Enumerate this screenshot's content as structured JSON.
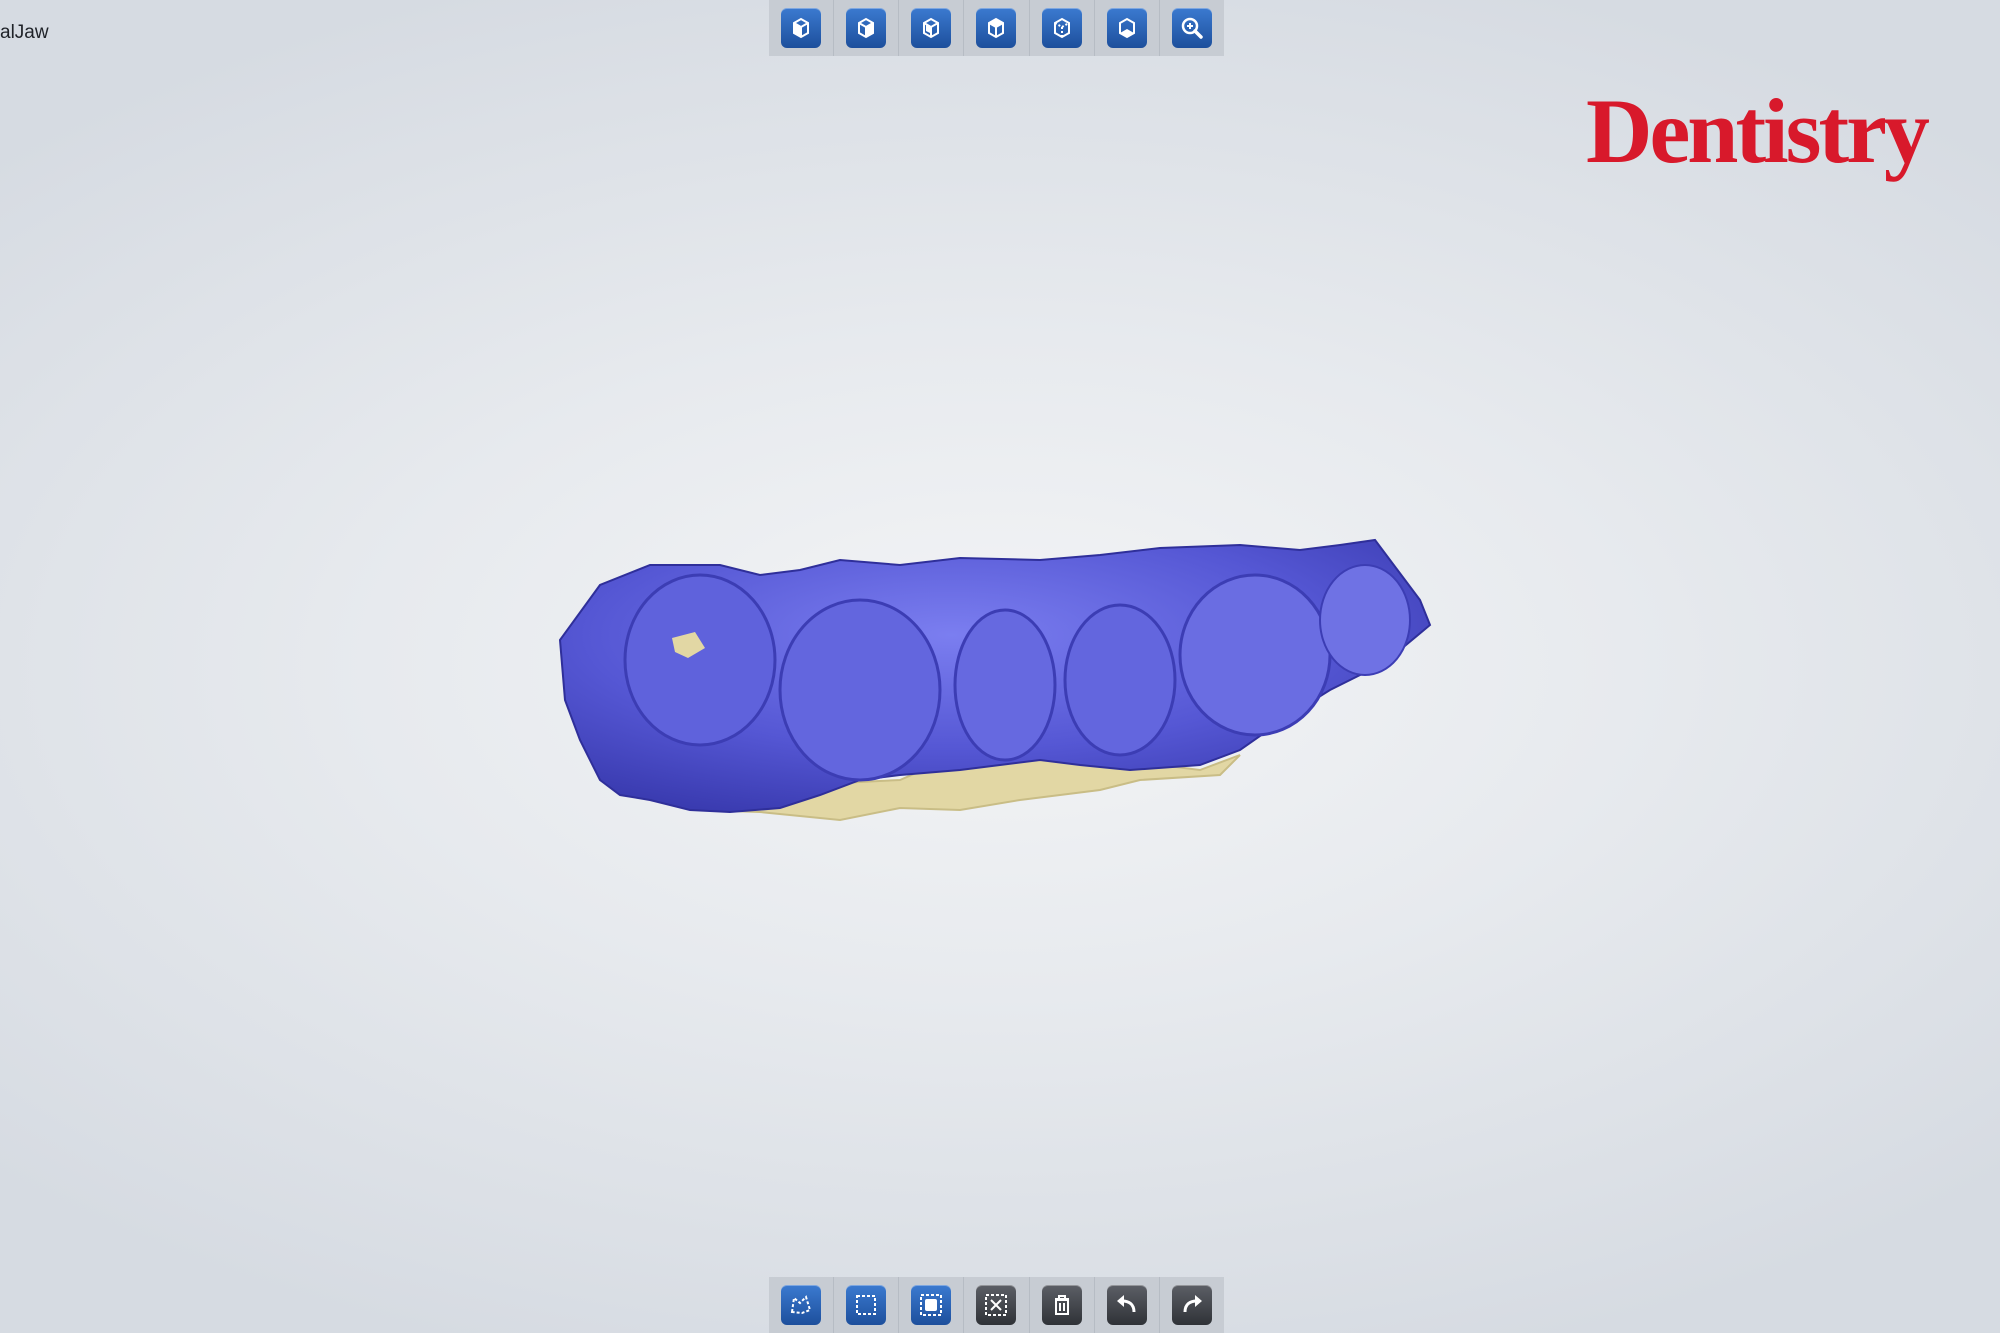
{
  "window": {
    "title": "alJaw"
  },
  "brand": {
    "logo_text": "Dentistry",
    "color": "#d8192b"
  },
  "top_toolbar": {
    "buttons": [
      {
        "icon": "view-cube-front-icon"
      },
      {
        "icon": "view-cube-right-icon"
      },
      {
        "icon": "view-cube-left-icon"
      },
      {
        "icon": "view-cube-top-icon"
      },
      {
        "icon": "view-cube-back-icon"
      },
      {
        "icon": "view-cube-bottom-icon"
      },
      {
        "icon": "zoom-icon"
      }
    ]
  },
  "bottom_toolbar": {
    "buttons": [
      {
        "icon": "lasso-select-icon"
      },
      {
        "icon": "rect-select-icon"
      },
      {
        "icon": "select-all-icon"
      },
      {
        "icon": "deselect-icon"
      },
      {
        "icon": "trash-icon"
      },
      {
        "icon": "undo-icon"
      },
      {
        "icon": "redo-icon"
      }
    ]
  },
  "model": {
    "scan_color": "#5a5bd6",
    "gum_color": "#e2d7a4"
  }
}
